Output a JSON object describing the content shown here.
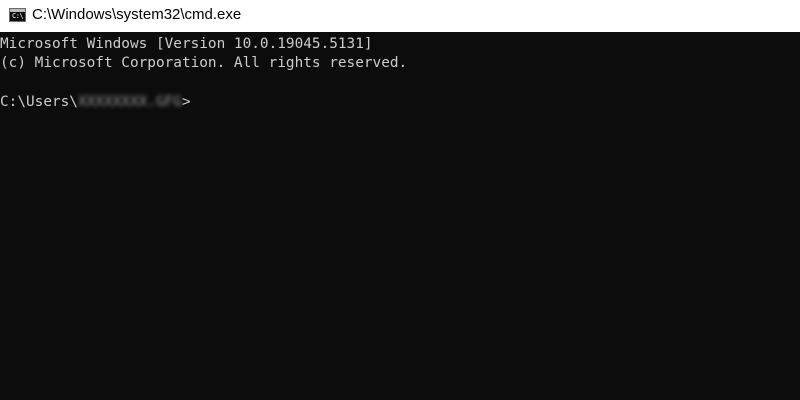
{
  "window": {
    "title": "C:\\Windows\\system32\\cmd.exe",
    "icon": "cmd-console-icon",
    "icon_glyph": "C:\\"
  },
  "console": {
    "line1": "Microsoft Windows [Version 10.0.19045.5131]",
    "line2": "(c) Microsoft Corporation. All rights reserved.",
    "prompt_prefix": "C:\\Users\\",
    "prompt_user_redacted": "XXXXXXXX.GFG",
    "prompt_suffix": ">"
  },
  "colors": {
    "console_background": "#0c0c0c",
    "console_text": "#cccccc",
    "titlebar_background": "#ffffff"
  }
}
